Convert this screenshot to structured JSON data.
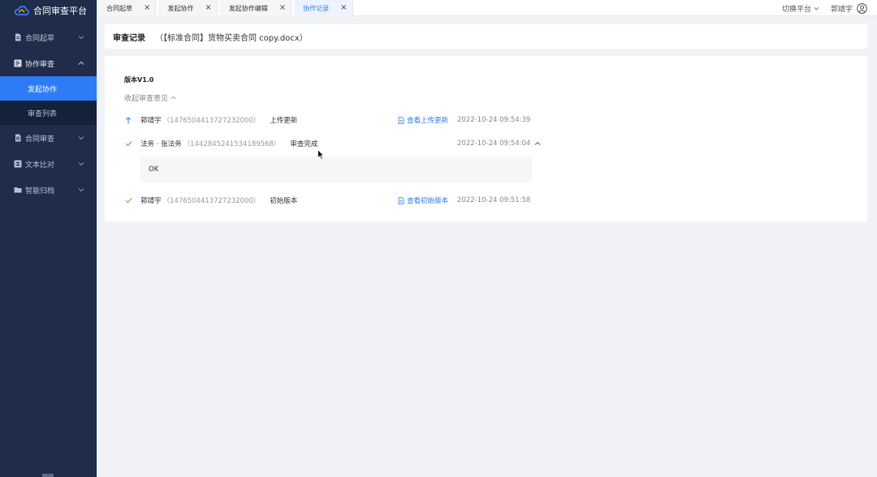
{
  "app": {
    "title": "合同审查平台"
  },
  "sidebar": {
    "items": [
      {
        "label": "合同起草",
        "icon": "document-icon",
        "expanded": false
      },
      {
        "label": "协作审查",
        "icon": "collab-icon",
        "expanded": true,
        "children": [
          {
            "label": "发起协作",
            "active": true
          },
          {
            "label": "审查列表",
            "active": false
          }
        ]
      },
      {
        "label": "合同审查",
        "icon": "review-icon",
        "expanded": false
      },
      {
        "label": "文本比对",
        "icon": "compare-icon",
        "expanded": false
      },
      {
        "label": "智能归档",
        "icon": "folder-icon",
        "expanded": false
      }
    ]
  },
  "tabs": [
    {
      "label": "合同起草",
      "active": false
    },
    {
      "label": "发起协作",
      "active": false
    },
    {
      "label": "发起协作编辑",
      "active": false
    },
    {
      "label": "协作记录",
      "active": true
    }
  ],
  "topbar": {
    "switch_platform": "切换平台",
    "user_name": "郭靖宇"
  },
  "header": {
    "title": "审查记录",
    "document": "（【标准合同】货物买卖合同 copy.docx）"
  },
  "record": {
    "version": "版本V1.0",
    "collapse_label": "收起审查意见",
    "entries": [
      {
        "status": "upload",
        "name": "郭靖宇",
        "id": "（1476504413727232000）",
        "action": "上传更新",
        "link": "查看上传更新",
        "time": "2022-10-24 09:54:39"
      },
      {
        "status": "done",
        "name": "法务 · 张法务",
        "id": "（1442845241534189568）",
        "action": "审查完成",
        "link": "",
        "time": "2022-10-24 09:54:04",
        "comment": "OK"
      },
      {
        "status": "done",
        "name": "郭靖宇",
        "id": "（1476504413727232000）",
        "action": "初始版本",
        "link": "查看初始版本",
        "time": "2022-10-24 09:51:58"
      }
    ]
  },
  "colors": {
    "sidebar_bg": "#1f2d4a",
    "accent": "#2d7cf6",
    "success": "#52c41a"
  }
}
